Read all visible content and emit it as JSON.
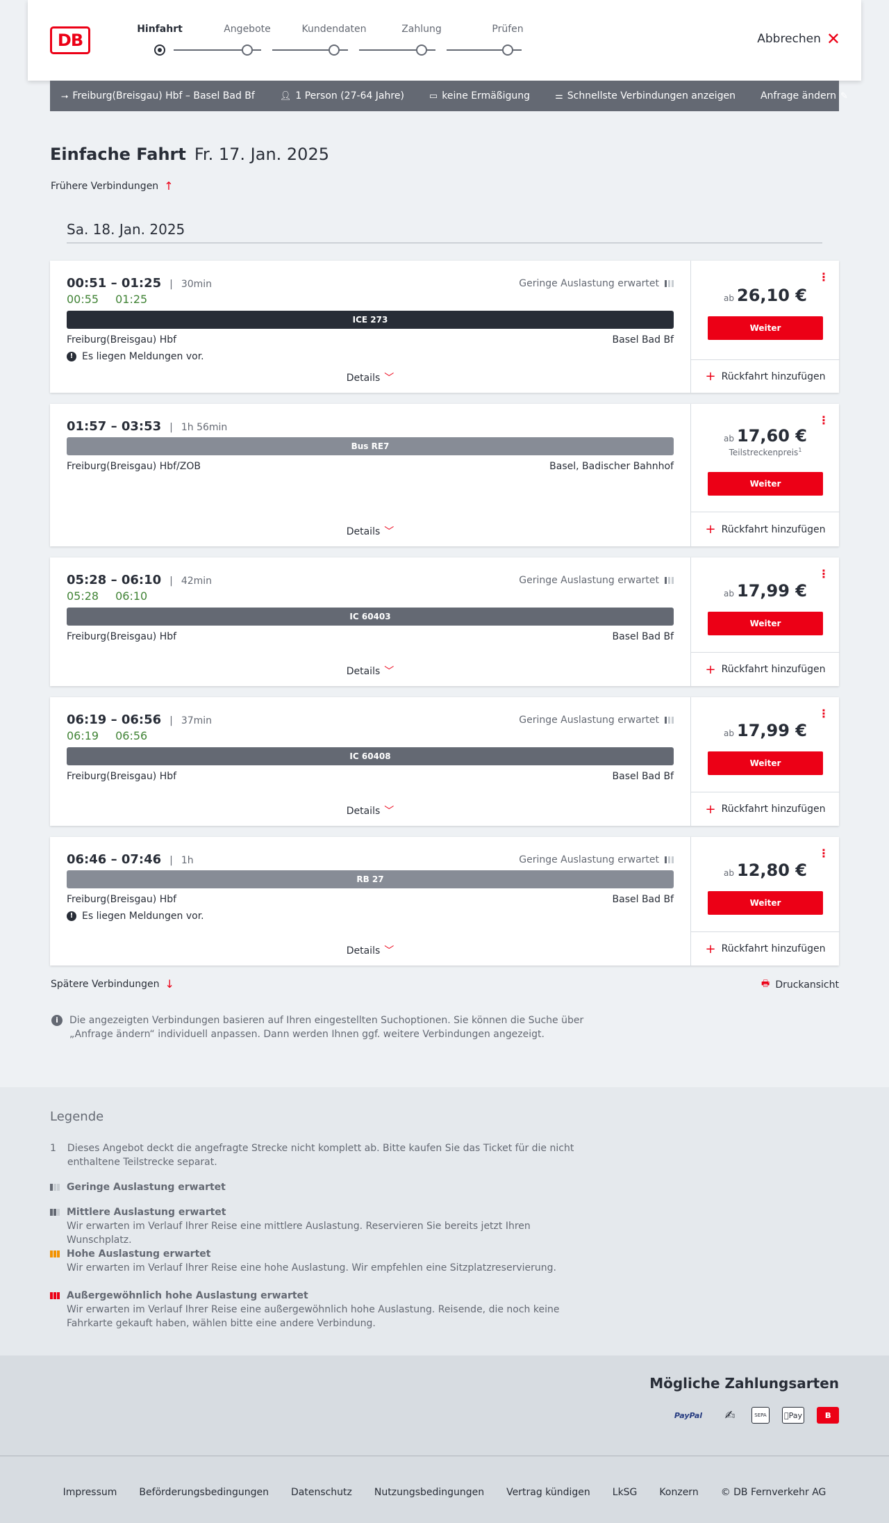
{
  "header": {
    "steps": [
      {
        "label": "Hinfahrt"
      },
      {
        "label": "Angebote"
      },
      {
        "label": "Kundendaten"
      },
      {
        "label": "Zahlung"
      },
      {
        "label": "Prüfen"
      }
    ],
    "active_step": "Hinfahrt",
    "cancel_label": "Abbrechen",
    "logo_text": "DB"
  },
  "summary": {
    "route": "Freiburg(Breisgau) Hbf – Basel Bad Bf",
    "persons": "1 Person (27-64 Jahre)",
    "discount": "keine Ermäßigung",
    "fastest": "Schnellste Verbindungen anzeigen",
    "edit": "Anfrage ändern"
  },
  "title": {
    "type": "Einfache Fahrt",
    "date": "Fr. 17. Jan. 2025"
  },
  "earlier": "Frühere Verbindungen",
  "date_divider": "Sa. 18. Jan. 2025",
  "connections": [
    {
      "times": "00:51 – 01:25",
      "duration": "30min",
      "realtime_dep": "00:55",
      "realtime_arr": "01:25",
      "load": "Geringe Auslastung erwartet",
      "train": "ICE 273",
      "train_color": "#282d37",
      "from": "Freiburg(Breisgau) Hbf",
      "to": "Basel Bad Bf",
      "notice": "Es liegen Meldungen vor.",
      "details": "Details",
      "price_prefix": "ab",
      "price": "26,10 €",
      "price_note": "",
      "button": "Weiter",
      "return": "Rückfahrt hinzufügen"
    },
    {
      "times": "01:57 – 03:53",
      "duration": "1h 56min",
      "realtime_dep": "",
      "realtime_arr": "",
      "load": "",
      "train": "Bus RE7",
      "train_color": "#878c96",
      "from": "Freiburg(Breisgau) Hbf/ZOB",
      "to": "Basel, Badischer Bahnhof",
      "notice": "",
      "details": "Details",
      "price_prefix": "ab",
      "price": "17,60 €",
      "price_note": "Teilstreckenpreis",
      "price_note_sup": "1",
      "button": "Weiter",
      "return": "Rückfahrt hinzufügen"
    },
    {
      "times": "05:28 – 06:10",
      "duration": "42min",
      "realtime_dep": "05:28",
      "realtime_arr": "06:10",
      "load": "Geringe Auslastung erwartet",
      "train": "IC 60403",
      "train_color": "#646973",
      "from": "Freiburg(Breisgau) Hbf",
      "to": "Basel Bad Bf",
      "notice": "",
      "details": "Details",
      "price_prefix": "ab",
      "price": "17,99 €",
      "price_note": "",
      "button": "Weiter",
      "return": "Rückfahrt hinzufügen"
    },
    {
      "times": "06:19 – 06:56",
      "duration": "37min",
      "realtime_dep": "06:19",
      "realtime_arr": "06:56",
      "load": "Geringe Auslastung erwartet",
      "train": "IC 60408",
      "train_color": "#646973",
      "from": "Freiburg(Breisgau) Hbf",
      "to": "Basel Bad Bf",
      "notice": "",
      "details": "Details",
      "price_prefix": "ab",
      "price": "17,99 €",
      "price_note": "",
      "button": "Weiter",
      "return": "Rückfahrt hinzufügen"
    },
    {
      "times": "06:46 – 07:46",
      "duration": "1h",
      "realtime_dep": "",
      "realtime_arr": "",
      "load": "Geringe Auslastung erwartet",
      "train": "RB 27",
      "train_color": "#878c96",
      "from": "Freiburg(Breisgau) Hbf",
      "to": "Basel Bad Bf",
      "notice": "Es liegen Meldungen vor.",
      "details": "Details",
      "price_prefix": "ab",
      "price": "12,80 €",
      "price_note": "",
      "button": "Weiter",
      "return": "Rückfahrt hinzufügen"
    }
  ],
  "later": "Spätere Verbindungen",
  "print": "Druckansicht",
  "info": "Die angezeigten Verbindungen basieren auf Ihren eingestellten Suchoptionen. Sie können die Suche über „Anfrage ändern“ individuell anpassen. Dann werden Ihnen ggf. weitere Verbindungen angezeigt.",
  "legend": {
    "title": "Legende",
    "footnote_num": "1",
    "footnote": "Dieses Angebot deckt die angefragte Strecke nicht komplett ab. Bitte kaufen Sie das Ticket für die nicht enthaltene Teilstrecke separat.",
    "items": [
      {
        "title": "Geringe Auslastung erwartet",
        "desc": "",
        "color": "#646973",
        "level": 1
      },
      {
        "title": "Mittlere Auslastung erwartet",
        "desc": "Wir erwarten im Verlauf Ihrer Reise eine mittlere Auslastung. Reservieren Sie bereits jetzt Ihren Wunschplatz.",
        "color": "#646973",
        "level": 2
      },
      {
        "title": "Hohe Auslastung erwartet",
        "desc": "Wir erwarten im Verlauf Ihrer Reise eine hohe Auslastung. Wir empfehlen eine Sitzplatzreservierung.",
        "color": "#f39200",
        "level": 3
      },
      {
        "title": "Außergewöhnlich hohe Auslastung erwartet",
        "desc": "Wir erwarten im Verlauf Ihrer Reise eine außergewöhnlich hohe Auslastung. Reisende, die noch keine Fahrkarte gekauft haben, wählen bitte eine andere Verbindung.",
        "color": "#ec0016",
        "level": 4
      }
    ]
  },
  "payment": {
    "title": "Mögliche Zahlungsarten",
    "methods": [
      {
        "name": "PayPal",
        "icon": "paypal-icon"
      },
      {
        "name": "",
        "icon": "credit-card-icon"
      },
      {
        "name": "SEPA",
        "icon": "sepa-icon"
      },
      {
        "name": "Pay",
        "icon": "apple-pay-icon"
      },
      {
        "name": "",
        "icon": "db-bonus-icon"
      }
    ]
  },
  "footer": {
    "links": [
      "Impressum",
      "Beförderungsbedingungen",
      "Datenschutz",
      "Nutzungsbedingungen",
      "Vertrag kündigen",
      "LkSG",
      "Konzern",
      "© DB Fernverkehr AG"
    ]
  },
  "colors": {
    "accent": "#ec0016",
    "realtime": "#408335",
    "summary_bg": "#646973"
  }
}
